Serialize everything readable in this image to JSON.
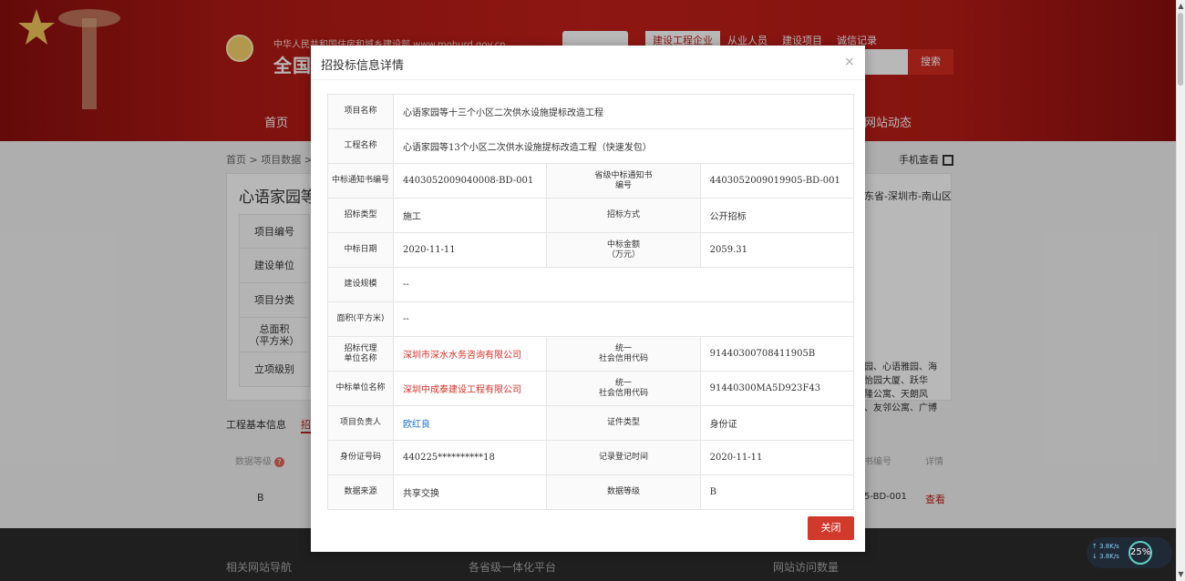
{
  "header": {
    "logo_top": "中华人民共和国住房和城乡建设部  www.mohurd.gov.cn",
    "logo_main": "全国",
    "tabs": [
      "建设工程企业",
      "从业人员",
      "建设项目",
      "诚信记录"
    ],
    "search_button": "搜索",
    "nav_home": "首页",
    "nav_news": "网站动态"
  },
  "page": {
    "breadcrumb": "首页  >  项目数据  >  项",
    "mobile_view": "手机查看",
    "card_title": "心语家园等",
    "card_location": "东省-深圳市-南山区",
    "left_labels": [
      "项目编号",
      "建设单位",
      "项目分类",
      "总面积\n（平方米）",
      "立项级别"
    ],
    "side_desc": "园、心语雅园、海\n怡园大厦、跃华\n隆公寓、天朗风\n、友邻公寓、广博",
    "tab_basic": "工程基本信息",
    "tab_bid": "招",
    "data_level": "数据等级",
    "data_level_q": "?",
    "row_level": "B",
    "cert_header": "书编号",
    "detail_header": "详情",
    "row_cert": "5-BD-001",
    "row_view": "查看"
  },
  "footer": {
    "nav": "相关网站导航",
    "platform": "各省级一体化平台",
    "visits": "网站访问数量"
  },
  "speed_widget": {
    "up": "↑ 3.8K/s",
    "down": "↓ 3.8K/s",
    "percent": "25%"
  },
  "modal": {
    "title": "招投标信息详情",
    "close_x": "×",
    "close_button": "关闭",
    "rows": {
      "project_name_label": "项目名称",
      "project_name": "心语家园等十三个小区二次供水设施提标改造工程",
      "engineering_name_label": "工程名称",
      "engineering_name": "心语家园等13个小区二次供水设施提标改造工程（快速发包）",
      "notice_no_label": "中标通知书编号",
      "notice_no": "4403052009040008-BD-001",
      "prov_notice_no_label": "省级中标通知书\n编号",
      "prov_notice_no": "4403052009019905-BD-001",
      "bid_type_label": "招标类型",
      "bid_type": "施工",
      "bid_method_label": "招标方式",
      "bid_method": "公开招标",
      "win_date_label": "中标日期",
      "win_date": "2020-11-11",
      "win_amount_label": "中标金额\n（万元）",
      "win_amount": "2059.31",
      "scale_label": "建设规模",
      "scale": "--",
      "area_label": "面积(平方米)",
      "area": "--",
      "agency_label": "招标代理\n单位名称",
      "agency": "深圳市深水水务咨询有限公司",
      "agency_code_label": "统一\n社会信用代码",
      "agency_code": "91440300708411905B",
      "winner_label": "中标单位名称",
      "winner": "深圳中成泰建设工程有限公司",
      "winner_code_label": "统一\n社会信用代码",
      "winner_code": "91440300MA5D923F43",
      "manager_label": "项目负责人",
      "manager": "欧红良",
      "id_type_label": "证件类型",
      "id_type": "身份证",
      "id_no_label": "身份证号码",
      "id_no": "440225**********18",
      "record_time_label": "记录登记时间",
      "record_time": "2020-11-11",
      "source_label": "数据来源",
      "source": "共享交换",
      "level_label": "数据等级",
      "level": "B"
    }
  },
  "colors": {
    "brand_red": "#c4201a",
    "link_red": "#d0312a",
    "link_blue": "#1a6fd1"
  }
}
